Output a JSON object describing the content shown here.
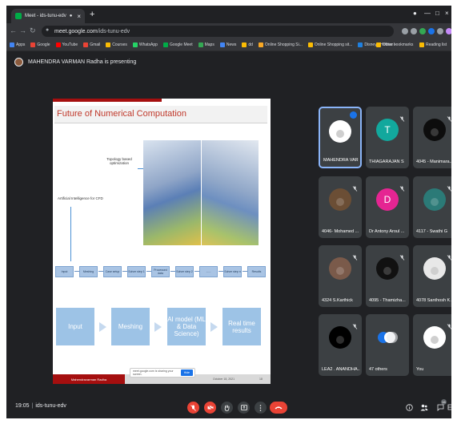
{
  "browser": {
    "tab_title": "Meet - ids-tunu-edv",
    "url_host": "meet.google.com",
    "url_path": "/ids-tunu-edv",
    "bookmarks": [
      "Apps",
      "Google",
      "YouTube",
      "Gmail",
      "Courses",
      "WhatsApp",
      "Google Meet",
      "Maps",
      "News",
      "dd",
      "Online Shopping Si...",
      "Online Shopping sit...",
      "Disney+ Hotstar -"
    ],
    "bookmark_colors": [
      "#4285f4",
      "#ea4335",
      "#ff0000",
      "#ea4335",
      "#fbbc04",
      "#25d366",
      "#00ac47",
      "#34a853",
      "#4285f4",
      "#fbbc04",
      "#f9a825",
      "#fbbc04",
      "#1f80e0"
    ],
    "other_bookmarks": "Other bookmarks",
    "reading_list": "Reading list"
  },
  "meeting": {
    "presenter_text": "MAHENDRA VARMAN Radha is presenting",
    "time": "19:05",
    "meeting_code": "ids-tunu-edv",
    "participant_count": "16"
  },
  "slide": {
    "title": "Future of Numerical Computation",
    "callout_topology": "Topology based optimization",
    "callout_ai": "Artificial Intelligence for CFD",
    "pipeline": [
      "Input",
      "Meshing",
      "Case setup",
      "Solver step 1",
      "Processed data",
      "Solver step 2",
      "......",
      "Solver step n",
      "Results"
    ],
    "flow": [
      "Input",
      "Meshing",
      "AI model (ML & Data Science)",
      "Real time results"
    ],
    "footer_left": "Mahendravarman Radha",
    "footer_date": "October 18, 2021",
    "footer_page": "18",
    "share_text": "meet.google.com is sharing your screen.",
    "share_hide": "Hide"
  },
  "participants": [
    {
      "name": "MAHENDRA VAR...",
      "initial": "",
      "color": "#ffffff",
      "active": true
    },
    {
      "name": "THIAGARAJAN S",
      "initial": "T",
      "color": "#12a89d",
      "active": false
    },
    {
      "name": "4045 - Manimara...",
      "initial": "",
      "color": "#0d0d0d",
      "active": false
    },
    {
      "name": "4046- Mohamed ...",
      "initial": "",
      "color": "#6b4e35",
      "active": false
    },
    {
      "name": "Dr Antony Aroul ...",
      "initial": "D",
      "color": "#e52592",
      "active": false
    },
    {
      "name": "4117 - Swathi G",
      "initial": "",
      "color": "#2b7a77",
      "active": false
    },
    {
      "name": "4324 S.Karthick",
      "initial": "",
      "color": "#7a5a4a",
      "active": false
    },
    {
      "name": "4095 - Thamizha...",
      "initial": "",
      "color": "#111111",
      "active": false
    },
    {
      "name": "4078 Santhosh K...",
      "initial": "",
      "color": "#e8e8e8",
      "active": false
    },
    {
      "name": "LEA2 . ANANDHA...",
      "initial": "",
      "color": "#000000",
      "active": false
    },
    {
      "name": "47 others",
      "initial": "",
      "color": "#ffffff",
      "active": false
    },
    {
      "name": "You",
      "initial": "",
      "color": "#ffffff",
      "active": false
    }
  ]
}
